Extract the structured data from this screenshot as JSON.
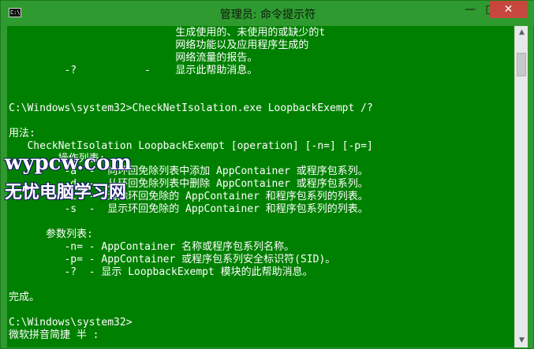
{
  "window": {
    "title": "管理员: 命令提示符",
    "icon": "cmd-icon",
    "buttons": {
      "minimize": "—",
      "maximize": "□",
      "close": "✕"
    }
  },
  "console": {
    "lines": [
      "                           生成使用的、未使用的或缺少的t",
      "                           网络功能以及应用程序生成的",
      "                           网络流量的报告。",
      "         -?           -    显示此帮助消息。",
      "",
      "",
      "C:\\Windows\\system32>CheckNetIsolation.exe LoopbackExempt /?",
      "",
      "用法:",
      "   CheckNetIsolation LoopbackExempt [operation] [-n=] [-p=]",
      "        操作列表:",
      "         -a  -  向环回免除列表中添加 AppContainer 或程序包系列。",
      "         -d  -  从环回免除列表中删除 AppContainer 或程序包系列。",
      "         -c  -  清除环回免除的 AppContainer 和程序包系列的列表。",
      "         -s  -  显示环回免除的 AppContainer 和程序包系列的列表。",
      "",
      "      参数列表:",
      "         -n= - AppContainer 名称或程序包系列名称。",
      "         -p= - AppContainer 或程序包系列安全标识符(SID)。",
      "         -?  - 显示 LoopbackExempt 模块的此帮助消息。",
      "",
      "完成。",
      "",
      "C:\\Windows\\system32>",
      "微软拼音简捷 半 :"
    ]
  },
  "watermark": {
    "url": "wypcw.com",
    "name": "无忧电脑学习网"
  },
  "colors": {
    "console_bg": "#008000",
    "console_fg": "#ffffff",
    "titlebar_bg": "#2f9a2f",
    "close_bg": "#c7473e"
  }
}
